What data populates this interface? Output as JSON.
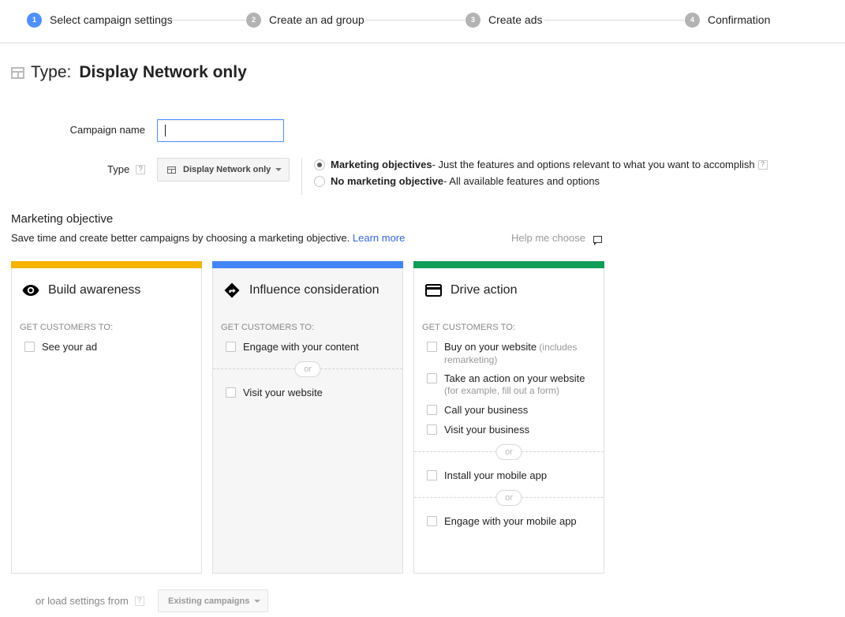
{
  "stepper": {
    "steps": [
      {
        "num": "1",
        "label": "Select campaign settings",
        "active": true
      },
      {
        "num": "2",
        "label": "Create an ad group",
        "active": false
      },
      {
        "num": "3",
        "label": "Create ads",
        "active": false
      },
      {
        "num": "4",
        "label": "Confirmation",
        "active": false
      }
    ]
  },
  "header": {
    "prefix": "Type:",
    "value": "Display Network only"
  },
  "form": {
    "campaign_name_label": "Campaign name",
    "campaign_name_value": "",
    "type_label": "Type",
    "help_glyph": "?",
    "type_dropdown": "Display Network only",
    "radio_options": [
      {
        "title": "Marketing objectives",
        "desc": " - Just the features and options relevant to what you want to accomplish",
        "checked": true
      },
      {
        "title": "No marketing objective",
        "desc": " - All available features and options",
        "checked": false
      }
    ]
  },
  "objective": {
    "heading": "Marketing objective",
    "description": "Save time and create better campaigns by choosing a marketing objective.",
    "learn_more": "Learn more",
    "help_me_choose": "Help me choose",
    "get_customers_label": "GET CUSTOMERS TO:",
    "or_label": "or",
    "colors": {
      "awareness": "#f4b400",
      "consideration": "#4285f4",
      "action": "#0f9d58"
    },
    "cards": [
      {
        "title": "Build awareness",
        "icon": "eye-icon",
        "options": [
          {
            "label": "See your ad",
            "sub": ""
          }
        ]
      },
      {
        "title": "Influence consideration",
        "icon": "directions-icon",
        "options": [
          {
            "label": "Engage with your content",
            "sub": ""
          },
          {
            "label": "Visit your website",
            "sub": ""
          }
        ]
      },
      {
        "title": "Drive action",
        "icon": "credit-card-icon",
        "options": [
          {
            "label": "Buy on your website",
            "sub": " (includes remarketing)"
          },
          {
            "label": "Take an action on your website",
            "sub": "(for example, fill out a form)"
          },
          {
            "label": "Call your business",
            "sub": ""
          },
          {
            "label": "Visit your business",
            "sub": ""
          },
          {
            "label": "Install your mobile app",
            "sub": ""
          },
          {
            "label": "Engage with your mobile app",
            "sub": ""
          }
        ]
      }
    ]
  },
  "footer": {
    "load_label": "or load settings from",
    "existing_button": "Existing campaigns"
  }
}
